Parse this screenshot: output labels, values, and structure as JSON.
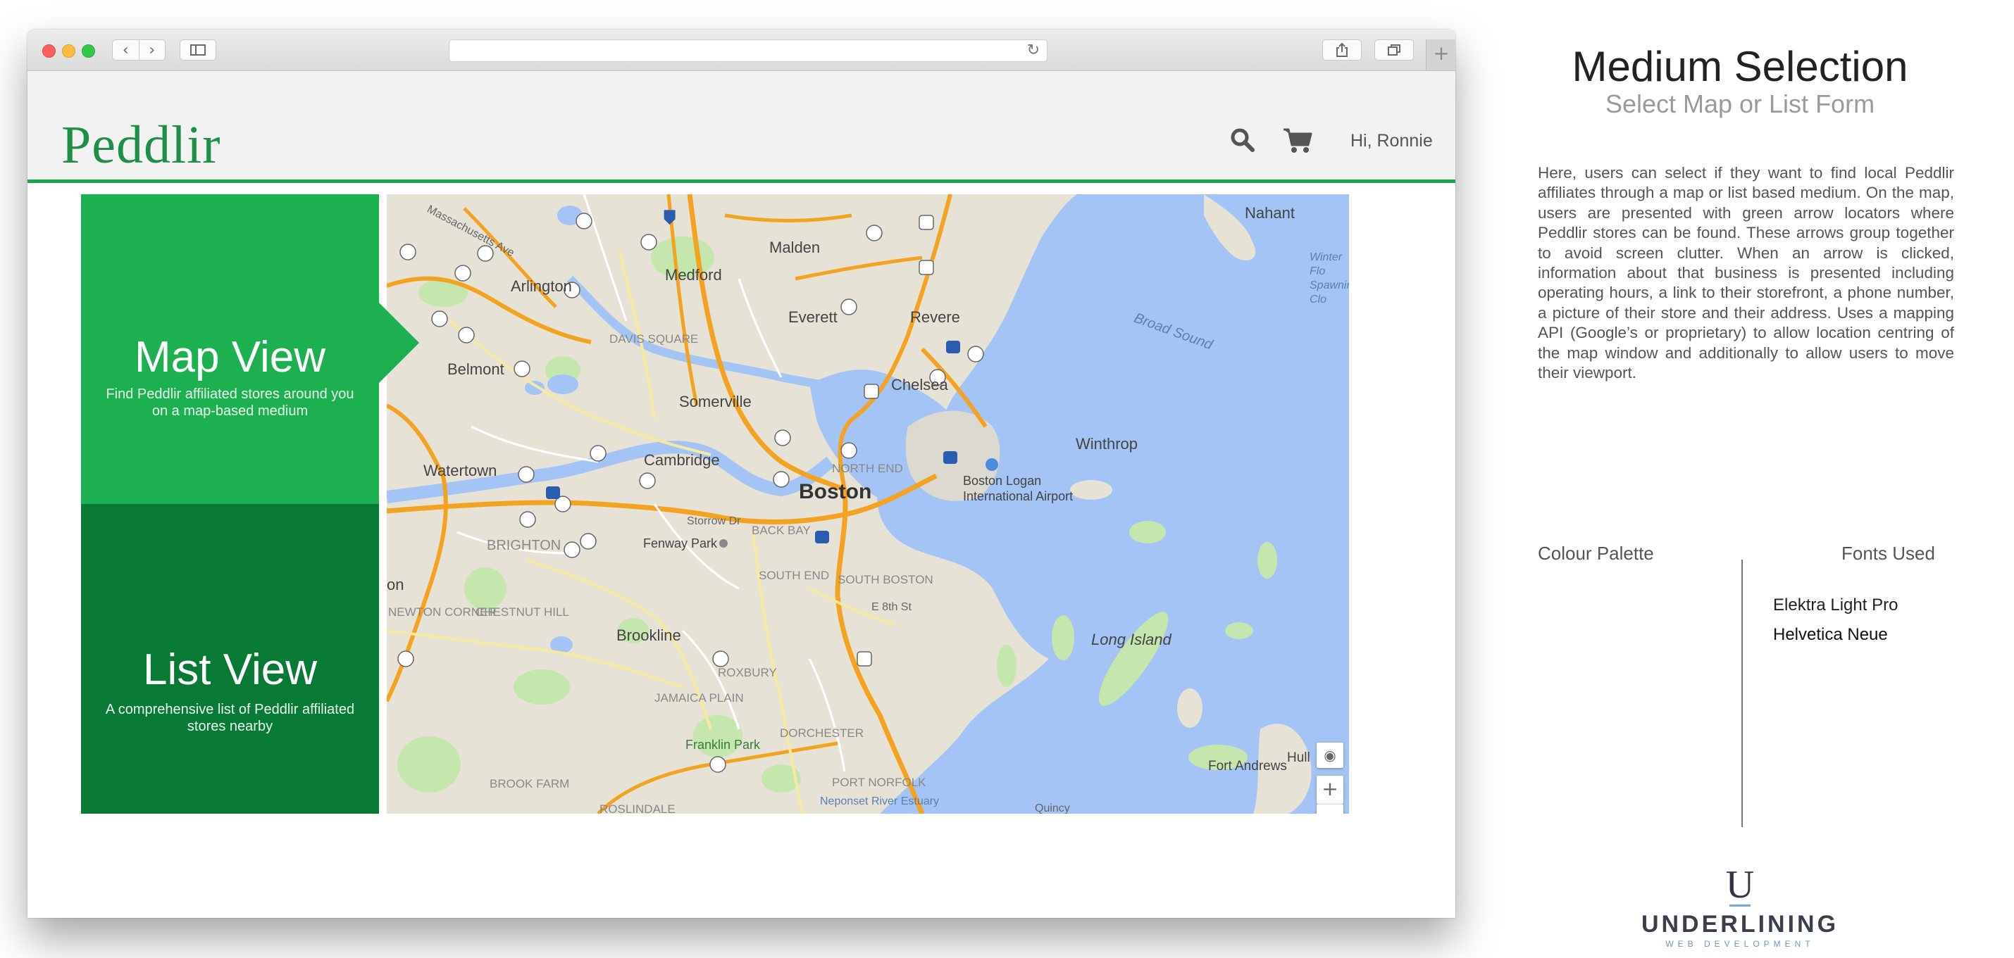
{
  "header": {
    "logo": "Peddlir",
    "greeting": "Hi, Ronnie"
  },
  "panels": {
    "map_view": {
      "title": "Map View",
      "description": "Find Peddlir affiliated stores around you on a map-based medium"
    },
    "list_view": {
      "title": "List View",
      "description": "A comprehensive list of Peddlir affiliated stores nearby"
    }
  },
  "map": {
    "labels": {
      "boston": "Boston",
      "cambridge": "Cambridge",
      "somerville": "Somerville",
      "medford": "Medford",
      "malden": "Malden",
      "everett": "Everett",
      "revere": "Revere",
      "chelsea": "Chelsea",
      "arlington": "Arlington",
      "belmont": "Belmont",
      "watertown": "Watertown",
      "brookline": "Brookline",
      "winthrop": "Winthrop",
      "nahant": "Nahant",
      "airport": "Boston Logan International Airport",
      "broad_sound": "Broad Sound",
      "long_island": "Long Island",
      "fort_andrews": "Fort Andrews",
      "hull": "Hull",
      "fenway": "Fenway Park",
      "franklin_park": "Franklin Park",
      "jamaica_plain": "JAMAICA PLAIN",
      "roxbury": "ROXBURY",
      "dorchester": "DORCHESTER",
      "south_boston": "SOUTH BOSTON",
      "south_end": "SOUTH END",
      "back_bay": "BACK BAY",
      "north_end": "NORTH END",
      "brighton": "BRIGHTON",
      "davis_square": "DAVIS SQUARE",
      "neponset": "Neponset River Estuary",
      "brook_farm": "BROOK FARM",
      "roslindale": "ROSLINDALE",
      "port_norfolk": "PORT NORFOLK",
      "newton_corner": "NEWTON CORNER",
      "chestnut_hill": "CHESTNUT HILL",
      "winter_flo": "Winter Flo Spawning Clo",
      "storrow": "Storrow Dr",
      "e8th": "E 8th St",
      "mass_ave": "Massachusetts Ave",
      "on": "on",
      "quincy": "Quincy"
    },
    "controls": {
      "zoom_in": "+",
      "zoom_out": "−",
      "locate": "◉"
    }
  },
  "info": {
    "title": "Medium Selection",
    "subtitle": "Select Map or List Form",
    "body": "Here, users can select if they want to find local Peddlir affiliates through a map or list based medium.  On the map, users are presented with green arrow locators where Peddlir stores can be found.  These arrows group together to avoid screen clutter.  When an arrow is clicked, information about that business is presented including operating hours, a link to their storefront, a phone number, a picture of their store and their address.  Uses a mapping API (Google’s or proprietary) to allow location centring of the map window and additionally to allow users to move their viewport.",
    "palette_heading": "Colour Palette",
    "fonts_heading": "Fonts Used",
    "fonts": [
      "Elektra Light Pro",
      "Helvetica Neue"
    ]
  },
  "brand": {
    "mark": "U",
    "name": "UNDERLINING",
    "tagline": "WEB DEVELOPMENT"
  },
  "browser": {
    "nav_back": "‹",
    "nav_forward": "›",
    "new_tab": "+",
    "reload": "↻"
  },
  "colors": {
    "brand_green": "#1cb050",
    "dark_green": "#097a35",
    "header_line": "#1aa64c",
    "logo_green": "#1f8f47"
  }
}
